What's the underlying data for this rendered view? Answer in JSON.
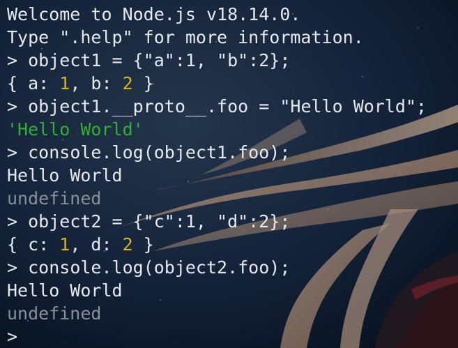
{
  "terminal": {
    "lines": [
      {
        "type": "text",
        "text": "Welcome to Node.js v18.14.0."
      },
      {
        "type": "text",
        "text": "Type \".help\" for more information."
      },
      {
        "type": "input",
        "prompt": "> ",
        "text": "object1 = {\"a\":1, \"b\":2};"
      },
      {
        "type": "object",
        "parts": [
          {
            "t": "{ a: ",
            "c": "text"
          },
          {
            "t": "1",
            "c": "num"
          },
          {
            "t": ", b: ",
            "c": "text"
          },
          {
            "t": "2",
            "c": "num"
          },
          {
            "t": " }",
            "c": "text"
          }
        ]
      },
      {
        "type": "input",
        "prompt": "> ",
        "text": "object1.__proto__.foo = \"Hello World\";"
      },
      {
        "type": "string",
        "text": "'Hello World'"
      },
      {
        "type": "input",
        "prompt": "> ",
        "text": "console.log(object1.foo);"
      },
      {
        "type": "text",
        "text": "Hello World"
      },
      {
        "type": "undefined",
        "text": "undefined"
      },
      {
        "type": "input",
        "prompt": "> ",
        "text": "object2 = {\"c\":1, \"d\":2};"
      },
      {
        "type": "object",
        "parts": [
          {
            "t": "{ c: ",
            "c": "text"
          },
          {
            "t": "1",
            "c": "num"
          },
          {
            "t": ", d: ",
            "c": "text"
          },
          {
            "t": "2",
            "c": "num"
          },
          {
            "t": " }",
            "c": "text"
          }
        ]
      },
      {
        "type": "input",
        "prompt": "> ",
        "text": "console.log(object2.foo);"
      },
      {
        "type": "text",
        "text": "Hello World"
      },
      {
        "type": "undefined",
        "text": "undefined"
      },
      {
        "type": "prompt",
        "prompt": ">"
      }
    ]
  },
  "colors": {
    "text": "#e6e9ef",
    "number": "#d6b51f",
    "string": "#2fb12f",
    "undefined": "#8b8f96"
  }
}
